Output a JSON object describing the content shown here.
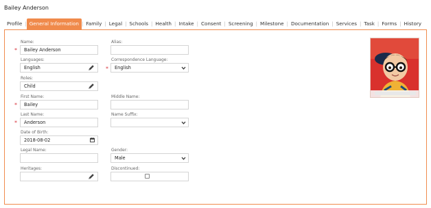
{
  "page_title": "Bailey Anderson",
  "tabs": [
    {
      "label": "Profile",
      "active": false
    },
    {
      "label": "General Information",
      "active": true
    },
    {
      "label": "Family",
      "active": false
    },
    {
      "label": "Legal",
      "active": false
    },
    {
      "label": "Schools",
      "active": false
    },
    {
      "label": "Health",
      "active": false
    },
    {
      "label": "Intake",
      "active": false
    },
    {
      "label": "Consent",
      "active": false
    },
    {
      "label": "Screening",
      "active": false
    },
    {
      "label": "Milestone",
      "active": false
    },
    {
      "label": "Documentation",
      "active": false
    },
    {
      "label": "Services",
      "active": false
    },
    {
      "label": "Task",
      "active": false
    },
    {
      "label": "Forms",
      "active": false
    },
    {
      "label": "History",
      "active": false
    }
  ],
  "form": {
    "name": {
      "label": "Name:",
      "value": "Bailey Anderson"
    },
    "alias": {
      "label": "Alias:",
      "value": ""
    },
    "languages": {
      "label": "Languages:",
      "value": "English"
    },
    "correspondence_language": {
      "label": "Correspondence Language:",
      "value": "English"
    },
    "roles": {
      "label": "Roles:",
      "value": "Child"
    },
    "first_name": {
      "label": "First Name:",
      "value": "Bailey"
    },
    "middle_name": {
      "label": "Middle Name:",
      "value": ""
    },
    "last_name": {
      "label": "Last Name:",
      "value": "Anderson"
    },
    "name_suffix": {
      "label": "Name Suffix:",
      "value": ""
    },
    "date_of_birth": {
      "label": "Date of Birth:",
      "value": "2018-08-02"
    },
    "legal_name": {
      "label": "Legal Name:",
      "value": ""
    },
    "gender": {
      "label": "Gender:",
      "value": "Male"
    },
    "heritages": {
      "label": "Heritages:",
      "value": ""
    },
    "discontinued": {
      "label": "Discontinued:",
      "checked": false
    }
  },
  "colors": {
    "accent": "#f08a4b",
    "required": "#d9363e",
    "photo_background": "#d9312d"
  },
  "icons": {
    "edit": "pencil-icon",
    "dropdown": "chevron-down-icon",
    "date": "calendar-icon"
  }
}
